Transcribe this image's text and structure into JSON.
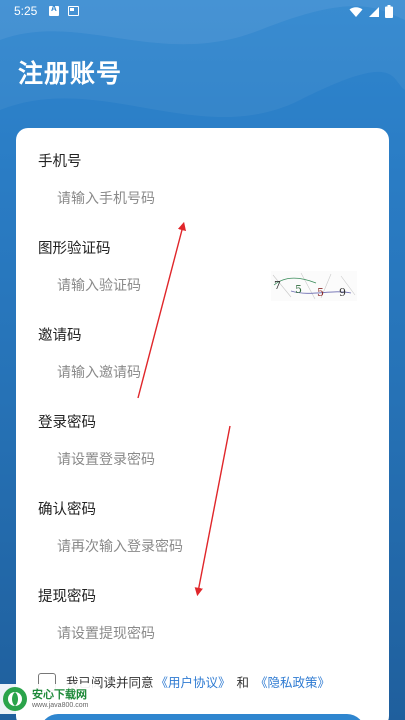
{
  "status_bar": {
    "time": "5:25",
    "icons": [
      "a-notification-icon",
      "screen-notification-icon",
      "wifi-icon",
      "signal-icon",
      "battery-icon"
    ]
  },
  "header": {
    "title": "注册账号"
  },
  "form": {
    "phone": {
      "label": "手机号",
      "placeholder": "请输入手机号码",
      "value": ""
    },
    "captcha": {
      "label": "图形验证码",
      "placeholder": "请输入验证码",
      "value": "",
      "image_digits": "7 5 5 9"
    },
    "invite": {
      "label": "邀请码",
      "placeholder": "请输入邀请码",
      "value": ""
    },
    "login_password": {
      "label": "登录密码",
      "placeholder": "请设置登录密码",
      "value": ""
    },
    "confirm_password": {
      "label": "确认密码",
      "placeholder": "请再次输入登录密码",
      "value": ""
    },
    "withdraw_password": {
      "label": "提现密码",
      "placeholder": "请设置提现密码",
      "value": ""
    }
  },
  "agreement": {
    "checked": false,
    "text": "我已阅读并同意",
    "user_agreement": "《用户协议》",
    "and": "和",
    "privacy_policy": "《隐私政策》"
  },
  "watermark": {
    "title": "安心下载网",
    "url": "www.java800.com"
  },
  "colors": {
    "background": "#2a7cc4",
    "card": "#ffffff",
    "link": "#2f7bd2",
    "annotation_arrow": "#e0262a"
  }
}
